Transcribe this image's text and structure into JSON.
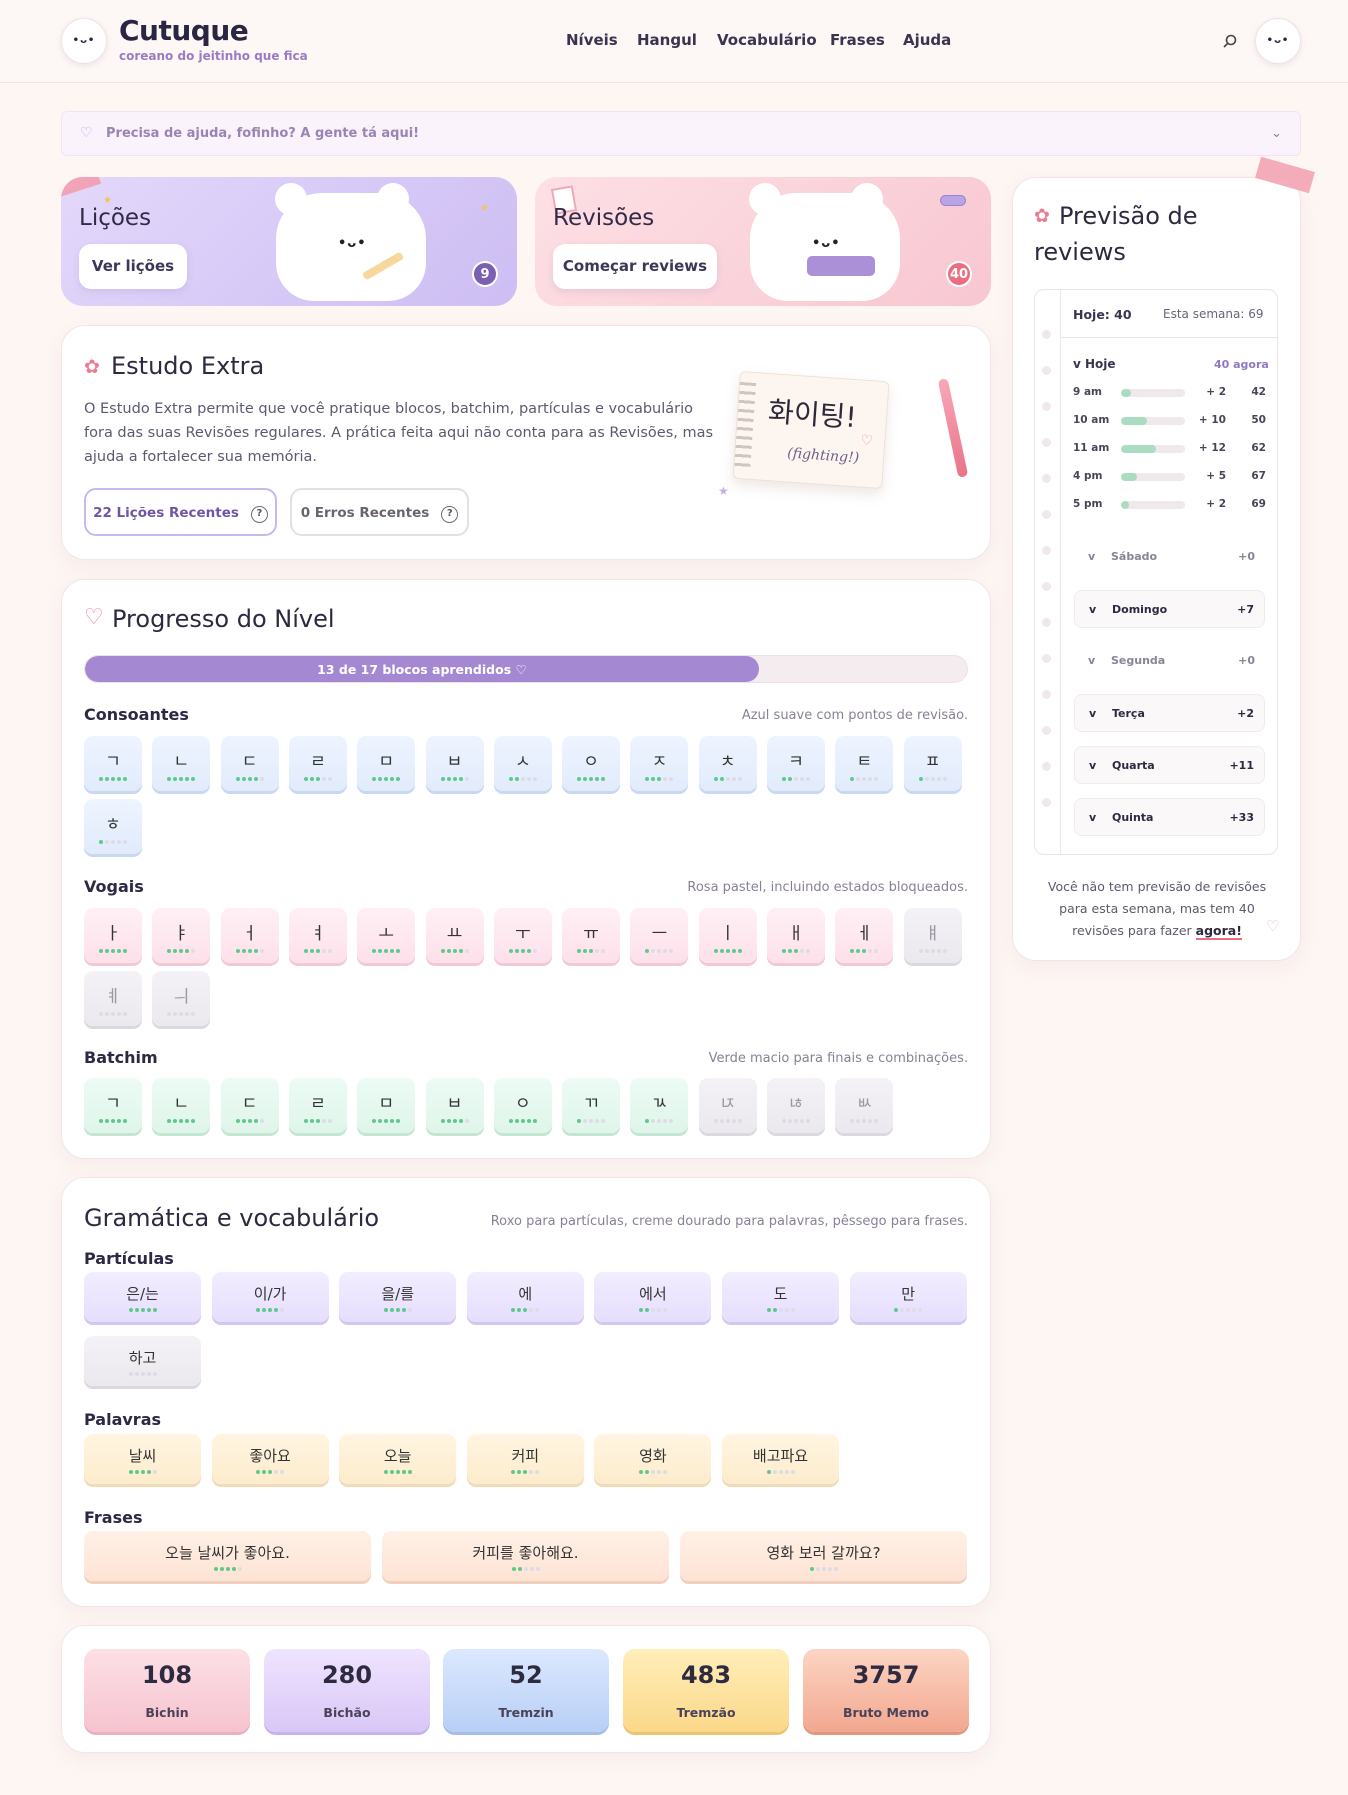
{
  "header": {
    "logo_face": "•ᴗ•",
    "brand": "Cutuque",
    "tagline": "coreano do jeitinho que fica",
    "nav": [
      "Níveis",
      "Hangul",
      "Vocabulário",
      "Frases",
      "Ajuda"
    ],
    "search_icon": "search-icon",
    "avatar_face": "•ᴗ•"
  },
  "help": {
    "text": "Precisa de ajuda, fofinho? A gente tá aqui!",
    "heart": "♡",
    "chevron": "⌄"
  },
  "lessons": {
    "title": "Lições",
    "button": "Ver lições",
    "count": "9",
    "face": "•ᴗ•"
  },
  "reviews": {
    "title": "Revisões",
    "button": "Começar reviews",
    "count": "40",
    "face": "•ᴗ•"
  },
  "extra": {
    "title": "Estudo Extra",
    "flower": "✿",
    "description": "O Estudo Extra permite que você pratique blocos, batchim, partículas e vocabulário fora das suas Revisões regulares. A prática feita aqui não conta para as Revisões, mas ajuda a fortalecer sua memória.",
    "recent_lessons": "22 Lições Recentes",
    "recent_errors": "0 Erros Recentes",
    "qm": "?",
    "note_korean": "화이팅!",
    "note_romaji": "(fighting!)"
  },
  "progress": {
    "title": "Progresso do Nível",
    "heart": "♡",
    "label": "13 de 17 blocos aprendidos ♡",
    "fraction": 0.764,
    "consonants": {
      "title": "Consoantes",
      "note": "Azul suave com pontos de revisão.",
      "items": [
        [
          "ㄱ",
          5
        ],
        [
          "ㄴ",
          5
        ],
        [
          "ㄷ",
          4
        ],
        [
          "ㄹ",
          3
        ],
        [
          "ㅁ",
          5
        ],
        [
          "ㅂ",
          4
        ],
        [
          "ㅅ",
          2
        ],
        [
          "ㅇ",
          5
        ],
        [
          "ㅈ",
          3
        ],
        [
          "ㅊ",
          2
        ],
        [
          "ㅋ",
          2
        ],
        [
          "ㅌ",
          1
        ],
        [
          "ㅍ",
          1
        ],
        [
          "ㅎ",
          1
        ]
      ]
    },
    "vowels": {
      "title": "Vogais",
      "note": "Rosa pastel, incluindo estados bloqueados.",
      "items": [
        [
          "ㅏ",
          5,
          "p"
        ],
        [
          "ㅑ",
          4,
          "p"
        ],
        [
          "ㅓ",
          4,
          "p"
        ],
        [
          "ㅕ",
          3,
          "p"
        ],
        [
          "ㅗ",
          5,
          "p"
        ],
        [
          "ㅛ",
          4,
          "p"
        ],
        [
          "ㅜ",
          4,
          "p"
        ],
        [
          "ㅠ",
          3,
          "p"
        ],
        [
          "ㅡ",
          1,
          "p"
        ],
        [
          "ㅣ",
          5,
          "p"
        ],
        [
          "ㅐ",
          3,
          "p"
        ],
        [
          "ㅔ",
          3,
          "p"
        ],
        [
          "ㅒ",
          0,
          "g"
        ],
        [
          "ㅖ",
          0,
          "g"
        ],
        [
          "ㅢ",
          0,
          "g"
        ]
      ]
    },
    "batchim": {
      "title": "Batchim",
      "note": "Verde macio para finais e combinações.",
      "items": [
        [
          "ㄱ",
          5,
          "t"
        ],
        [
          "ㄴ",
          5,
          "t"
        ],
        [
          "ㄷ",
          4,
          "t"
        ],
        [
          "ㄹ",
          3,
          "t"
        ],
        [
          "ㅁ",
          5,
          "t"
        ],
        [
          "ㅂ",
          4,
          "t"
        ],
        [
          "ㅇ",
          5,
          "t"
        ],
        [
          "ㄲ",
          1,
          "t"
        ],
        [
          "ㄳ",
          1,
          "t"
        ],
        [
          "ㄵ",
          0,
          "g"
        ],
        [
          "ㄶ",
          0,
          "g"
        ],
        [
          "ㅄ",
          0,
          "g"
        ]
      ]
    }
  },
  "grammar": {
    "title": "Gramática e vocabulário",
    "note": "Roxo para partículas, creme dourado para palavras, pêssego para frases.",
    "particles": {
      "title": "Partículas",
      "items": [
        [
          "은/는",
          5
        ],
        [
          "이/가",
          4
        ],
        [
          "을/를",
          4
        ],
        [
          "에",
          3
        ],
        [
          "에서",
          2
        ],
        [
          "도",
          2
        ],
        [
          "만",
          1
        ],
        [
          "하고",
          0
        ]
      ]
    },
    "words": {
      "title": "Palavras",
      "items": [
        [
          "날씨",
          4
        ],
        [
          "좋아요",
          3
        ],
        [
          "오늘",
          5
        ],
        [
          "커피",
          3
        ],
        [
          "영화",
          2
        ],
        [
          "배고파요",
          1
        ]
      ]
    },
    "phrases": {
      "title": "Frases",
      "items": [
        [
          "오늘 날씨가 좋아요.",
          4
        ],
        [
          "커피를 좋아해요.",
          2
        ],
        [
          "영화 보러 갈까요?",
          1
        ]
      ]
    }
  },
  "stats": [
    {
      "value": "108",
      "label": "Bichin"
    },
    {
      "value": "280",
      "label": "Bichão"
    },
    {
      "value": "52",
      "label": "Tremzin"
    },
    {
      "value": "483",
      "label": "Tremzão"
    },
    {
      "value": "3757",
      "label": "Bruto Memo"
    }
  ],
  "forecast": {
    "title": "Previsão de reviews",
    "flower": "✿",
    "today": "Hoje: 40",
    "week": "Esta semana: 69",
    "today_header": "v Hoje",
    "now": "40 agora",
    "hours": [
      [
        "9 am",
        "+ 2",
        "42",
        0.15
      ],
      [
        "10 am",
        "+ 10",
        "50",
        0.4
      ],
      [
        "11 am",
        "+ 12",
        "62",
        0.55
      ],
      [
        "4 pm",
        "+ 5",
        "67",
        0.25
      ],
      [
        "5 pm",
        "+ 2",
        "69",
        0.12
      ]
    ],
    "days": [
      [
        "v",
        "Sábado",
        "+0",
        false
      ],
      [
        "v",
        "Domingo",
        "+7",
        true
      ],
      [
        "v",
        "Segunda",
        "+0",
        false
      ],
      [
        "v",
        "Terça",
        "+2",
        true
      ],
      [
        "v",
        "Quarta",
        "+11",
        true
      ],
      [
        "v",
        "Quinta",
        "+33",
        true
      ]
    ],
    "footer_a": "Você não tem previsão de revisões",
    "footer_b": "para esta semana, mas tem 40",
    "footer_c": "revisões para fazer ",
    "footer_link": "agora!",
    "heart": "♡"
  }
}
